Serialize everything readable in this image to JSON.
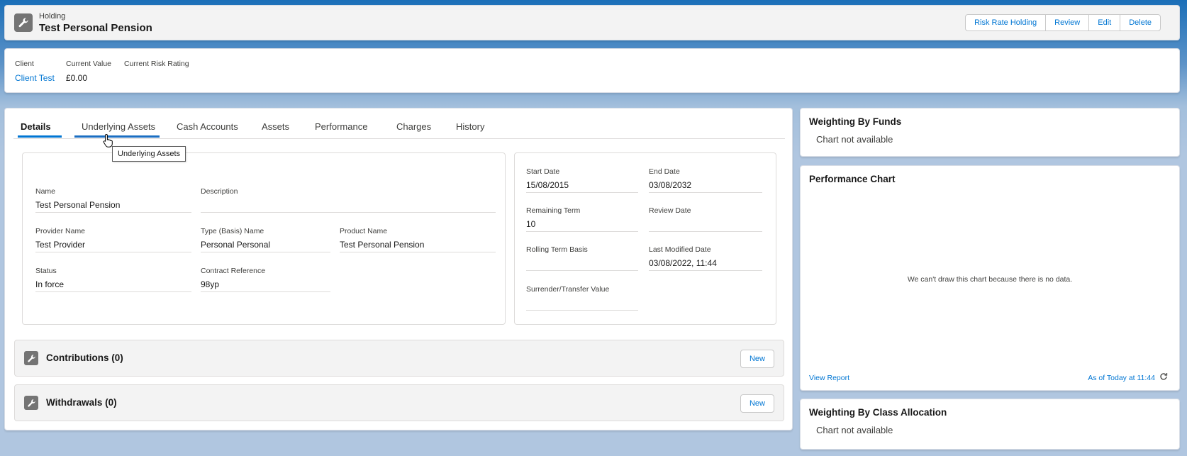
{
  "header": {
    "object_label": "Holding",
    "title": "Test Personal Pension",
    "icon": "wrench-icon",
    "actions": [
      "Risk Rate Holding",
      "Review",
      "Edit",
      "Delete"
    ]
  },
  "highlights": [
    {
      "label": "Client",
      "value": "Client Test"
    },
    {
      "label": "Current Value",
      "value": "£0.00"
    },
    {
      "label": "Current Risk Rating",
      "value": ""
    }
  ],
  "tabs": [
    {
      "label": "Details"
    },
    {
      "label": "Underlying Assets"
    },
    {
      "label": "Cash Accounts"
    },
    {
      "label": "Assets"
    },
    {
      "label": "Performance"
    },
    {
      "label": "Charges"
    },
    {
      "label": "History"
    }
  ],
  "active_tab": "Details",
  "hovered_tab": "Underlying Assets",
  "tooltip": "Underlying Assets",
  "details_left": {
    "name": {
      "label": "Name",
      "value": "Test Personal Pension"
    },
    "description": {
      "label": "Description",
      "value": ""
    },
    "provider_name": {
      "label": "Provider Name",
      "value": "Test Provider"
    },
    "type_name": {
      "label": "Type (Basis) Name",
      "value": "Personal Personal"
    },
    "product_name": {
      "label": "Product Name",
      "value": "Test Personal Pension"
    },
    "status": {
      "label": "Status",
      "value": "In force"
    },
    "contract_reference": {
      "label": "Contract Reference",
      "value": "98yp"
    }
  },
  "details_right": {
    "start_date": {
      "label": "Start Date",
      "value": "15/08/2015"
    },
    "end_date": {
      "label": "End Date",
      "value": "03/08/2032"
    },
    "remaining_term": {
      "label": "Remaining Term",
      "value": "10"
    },
    "review_date": {
      "label": "Review Date",
      "value": ""
    },
    "rolling_term_basis": {
      "label": "Rolling Term Basis",
      "value": ""
    },
    "last_modified_date": {
      "label": "Last Modified Date",
      "value": "03/08/2022, 11:44"
    },
    "surrender_value": {
      "label": "Surrender/Transfer Value",
      "value": ""
    }
  },
  "related": [
    {
      "title": "Contributions (0)",
      "button": "New"
    },
    {
      "title": "Withdrawals (0)",
      "button": "New"
    }
  ],
  "side": {
    "weighting_funds": {
      "title": "Weighting By Funds",
      "message": "Chart not available"
    },
    "performance_chart": {
      "title": "Performance Chart",
      "message": "We can't draw this chart because there is no data.",
      "view_report": "View Report",
      "as_of": "As of Today at 11:44"
    },
    "weighting_class": {
      "title": "Weighting By Class Allocation",
      "message": "Chart not available"
    }
  },
  "colors": {
    "brand": "#0176d3",
    "icon_bg": "#747474"
  }
}
